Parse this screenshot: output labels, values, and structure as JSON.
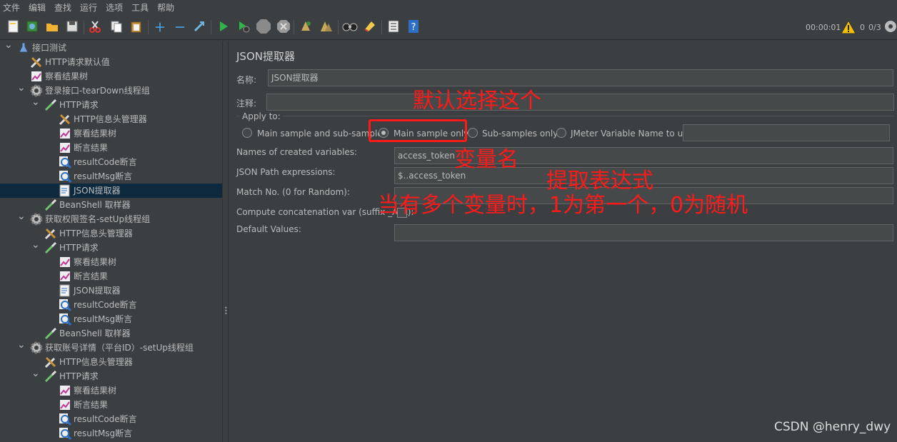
{
  "menu": [
    "文件",
    "编辑",
    "查找",
    "运行",
    "选项",
    "工具",
    "帮助"
  ],
  "status": {
    "timer": "00:00:01",
    "warnings": "0",
    "threads": "0/3"
  },
  "tree": [
    {
      "label": "接口测试",
      "level": 0,
      "icon": "flask-icon",
      "expanded": true
    },
    {
      "label": "HTTP请求默认值",
      "level": 1,
      "icon": "wrench-icon"
    },
    {
      "label": "察看结果树",
      "level": 1,
      "icon": "chart-icon"
    },
    {
      "label": "登录接口-tearDown线程组",
      "level": 1,
      "icon": "gear-icon",
      "expanded": true
    },
    {
      "label": "HTTP请求",
      "level": 2,
      "icon": "pipette-icon",
      "expanded": true
    },
    {
      "label": "HTTP信息头管理器",
      "level": 3,
      "icon": "wrench-icon"
    },
    {
      "label": "察看结果树",
      "level": 3,
      "icon": "chart-icon"
    },
    {
      "label": "断言结果",
      "level": 3,
      "icon": "chart-icon"
    },
    {
      "label": "resultCode断言",
      "level": 3,
      "icon": "magnifier-icon"
    },
    {
      "label": "resultMsg断言",
      "level": 3,
      "icon": "magnifier-icon"
    },
    {
      "label": "JSON提取器",
      "level": 3,
      "icon": "document-icon",
      "selected": true
    },
    {
      "label": "BeanShell 取样器",
      "level": 2,
      "icon": "pipette-icon"
    },
    {
      "label": "获取权限签名-setUp线程组",
      "level": 1,
      "icon": "gear-icon",
      "expanded": true
    },
    {
      "label": "HTTP信息头管理器",
      "level": 2,
      "icon": "wrench-icon"
    },
    {
      "label": "HTTP请求",
      "level": 2,
      "icon": "pipette-icon",
      "expanded": true
    },
    {
      "label": "察看结果树",
      "level": 3,
      "icon": "chart-icon"
    },
    {
      "label": "断言结果",
      "level": 3,
      "icon": "chart-icon"
    },
    {
      "label": "JSON提取器",
      "level": 3,
      "icon": "document-icon"
    },
    {
      "label": "resultCode断言",
      "level": 3,
      "icon": "magnifier-icon"
    },
    {
      "label": "resultMsg断言",
      "level": 3,
      "icon": "magnifier-icon"
    },
    {
      "label": "BeanShell 取样器",
      "level": 2,
      "icon": "pipette-icon"
    },
    {
      "label": "获取账号详情（平台ID）-setUp线程组",
      "level": 1,
      "icon": "gear-icon",
      "expanded": true
    },
    {
      "label": "HTTP信息头管理器",
      "level": 2,
      "icon": "wrench-icon"
    },
    {
      "label": "HTTP请求",
      "level": 2,
      "icon": "pipette-icon",
      "expanded": true
    },
    {
      "label": "察看结果树",
      "level": 3,
      "icon": "chart-icon"
    },
    {
      "label": "断言结果",
      "level": 3,
      "icon": "chart-icon"
    },
    {
      "label": "resultCode断言",
      "level": 3,
      "icon": "magnifier-icon"
    },
    {
      "label": "resultMsg断言",
      "level": 3,
      "icon": "magnifier-icon"
    }
  ],
  "panel": {
    "title": "JSON提取器",
    "name_label": "名称:",
    "name_value": "JSON提取器",
    "comment_label": "注释:",
    "comment_value": "",
    "apply_to_label": "Apply to:",
    "apply_options": [
      "Main sample and sub-samples",
      "Main sample only",
      "Sub-samples only",
      "JMeter Variable Name to use"
    ],
    "apply_selected": 1,
    "var_name_field": "",
    "names_label": "Names of created variables:",
    "names_value": "access_token",
    "jsonpath_label": "JSON Path expressions:",
    "jsonpath_value": "$..access_token",
    "match_label": "Match No. (0 for Random):",
    "match_value": "",
    "concat_label": "Compute concatenation var (suffix _ALL):",
    "concat_checked": false,
    "default_label": "Default Values:",
    "default_value": ""
  },
  "annotations": {
    "default_select": "默认选择这个",
    "var_name": "变量名",
    "extract_expr": "提取表达式",
    "match_note": "当有多个变量时，1为第一个，0为随机"
  },
  "watermark": "CSDN @henry_dwy"
}
